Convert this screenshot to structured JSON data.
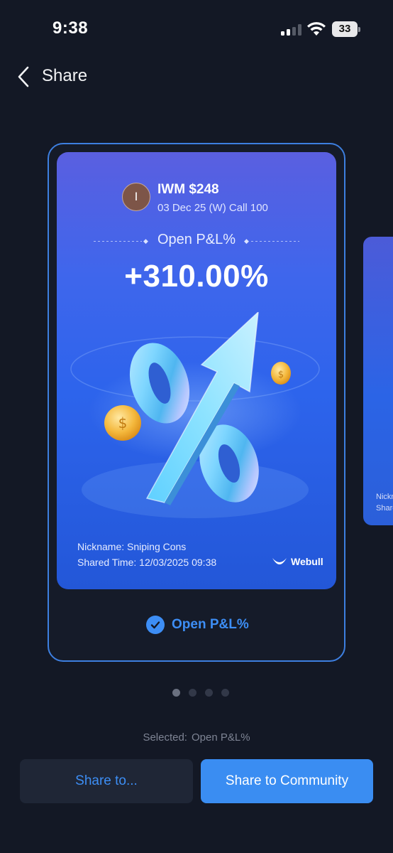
{
  "status_bar": {
    "time": "9:38",
    "battery": "33"
  },
  "header": {
    "title": "Share"
  },
  "card": {
    "avatar_initial": "I",
    "ticker": "IWM $248",
    "contract": "03 Dec 25 (W) Call 100",
    "pnl_label": "Open P&L%",
    "pnl_value": "+310.00%",
    "nickname": "Nickname: Sniping Cons",
    "shared_time": "Shared Time: 12/03/2025 09:38",
    "brand": "Webull"
  },
  "next_card_peek": {
    "line1": "Nickn",
    "line2": "Share"
  },
  "option": {
    "label": "Open P&L%",
    "checked": true
  },
  "pagination": {
    "pages": 4,
    "active": 0
  },
  "selected": {
    "prefix": "Selected:",
    "value": "Open P&L%"
  },
  "buttons": {
    "share_to": "Share to...",
    "share_community": "Share to Community"
  },
  "colors": {
    "background": "#131825",
    "accent": "#3d8ef5",
    "card_frame": "#3d7fe0"
  }
}
